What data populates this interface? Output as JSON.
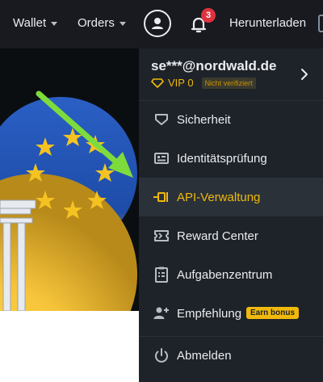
{
  "topbar": {
    "wallet_label": "Wallet",
    "orders_label": "Orders",
    "notification_count": "3",
    "download_label": "Herunterladen"
  },
  "account": {
    "email": "se***@nordwald.de",
    "vip_level": "VIP 0",
    "verification_status": "Nicht verifiziert"
  },
  "menu": {
    "items": [
      {
        "label": "Sicherheit",
        "icon": "shield-icon"
      },
      {
        "label": "Identitätsprüfung",
        "icon": "id-card-icon"
      },
      {
        "label": "API-Verwaltung",
        "icon": "api-key-icon",
        "active": true
      },
      {
        "label": "Reward Center",
        "icon": "ticket-icon"
      },
      {
        "label": "Aufgabenzentrum",
        "icon": "clipboard-icon"
      },
      {
        "label": "Empfehlung",
        "icon": "add-user-icon",
        "badge": "Earn bonus"
      },
      {
        "label": "Abmelden",
        "icon": "power-icon"
      }
    ]
  },
  "colors": {
    "topbar_bg": "#181a20",
    "menu_bg": "#1e2329",
    "accent": "#f0b90b",
    "badge_red": "#e0323f",
    "eu_blue": "#1d4fb0",
    "annotation_arrow": "#7ddc3b"
  }
}
